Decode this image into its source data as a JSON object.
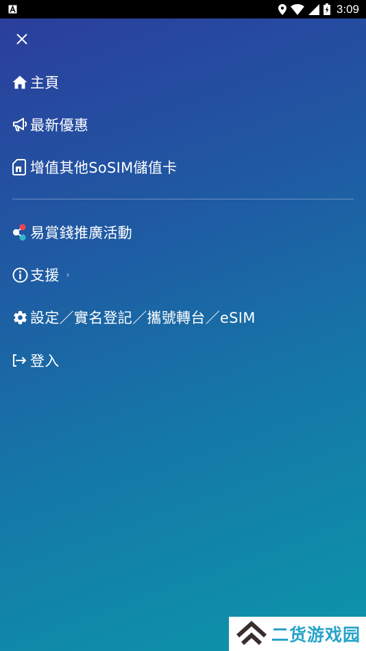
{
  "status_bar": {
    "time": "3:09",
    "left_icon": "notification-a-icon",
    "icons": [
      "location-icon",
      "wifi-icon",
      "signal-icon",
      "battery-icon"
    ]
  },
  "menu": {
    "close_icon": "close-icon",
    "items": [
      {
        "label": "主頁",
        "icon": "home-icon"
      },
      {
        "label": "最新優惠",
        "icon": "megaphone-icon"
      },
      {
        "label": "增值其他SoSIM儲值卡",
        "icon": "sim-card-icon"
      },
      {
        "label": "易賞錢推廣活動",
        "icon": "yuu-logo-icon"
      },
      {
        "label": "支援",
        "icon": "info-icon"
      },
      {
        "label": "設定／實名登記／攜號轉台／eSIM",
        "icon": "gear-icon"
      },
      {
        "label": "登入",
        "icon": "login-icon"
      }
    ]
  },
  "watermark": {
    "text": "二货游戏园"
  },
  "colors": {
    "gradient_start": "#2c3c9c",
    "gradient_end": "#0d96aa",
    "watermark_text": "#27a3c9",
    "watermark_logo": "#3a2e2c"
  }
}
